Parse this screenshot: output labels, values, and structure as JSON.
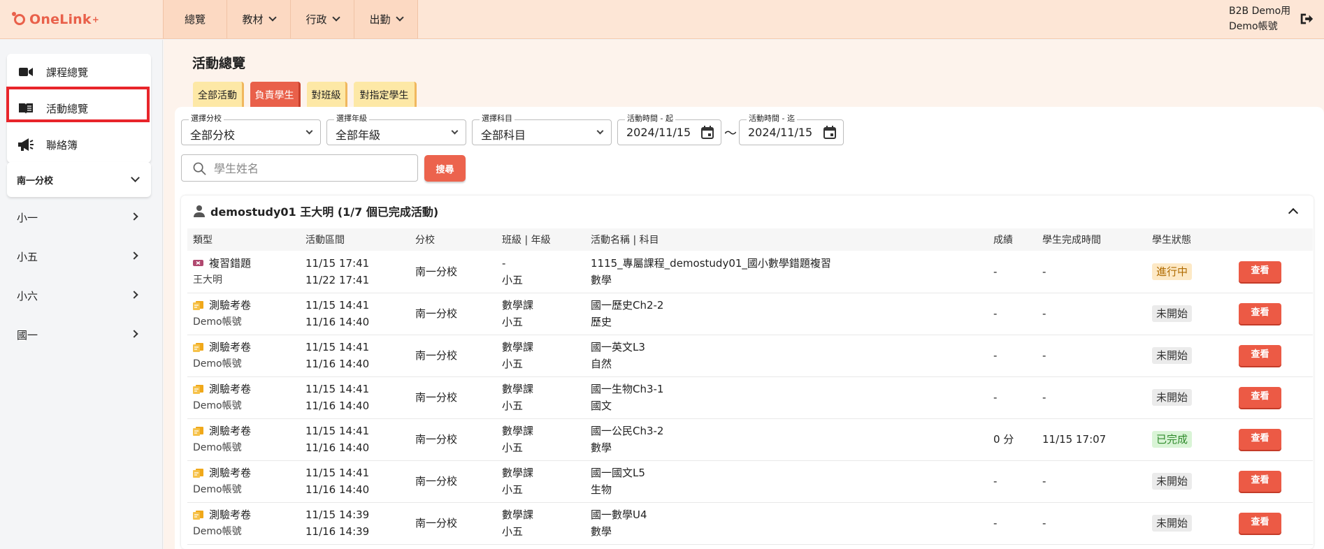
{
  "header": {
    "logo_text": "OneLink",
    "logo_plus": "+",
    "nav": [
      {
        "label": "總覽",
        "has_menu": false
      },
      {
        "label": "教材",
        "has_menu": true
      },
      {
        "label": "行政",
        "has_menu": true
      },
      {
        "label": "出勤",
        "has_menu": true
      }
    ],
    "user_line1": "B2B Demo用",
    "user_line2": "Demo帳號",
    "logout_icon": "logout-icon"
  },
  "sidebar": {
    "links": [
      {
        "label": "課程總覽",
        "icon": "video-camera-icon"
      },
      {
        "label": "活動總覽",
        "icon": "open-book-icon"
      },
      {
        "label": "聯絡簿",
        "icon": "megaphone-icon"
      }
    ],
    "branch": "南一分校",
    "grades": [
      "小一",
      "小五",
      "小六",
      "國一"
    ]
  },
  "page": {
    "title": "活動總覽",
    "tabs": [
      "全部活動",
      "負責學生",
      "對班級",
      "對指定學生"
    ],
    "active_tab": 1
  },
  "filters": {
    "branch": {
      "label": "選擇分校",
      "value": "全部分校"
    },
    "grade": {
      "label": "選擇年級",
      "value": "全部年級"
    },
    "subject": {
      "label": "選擇科目",
      "value": "全部科目"
    },
    "start": {
      "label": "活動時間 - 起",
      "value": "2024/11/15"
    },
    "end": {
      "label": "活動時間 - 迄",
      "value": "2024/11/15"
    },
    "separator": "～",
    "search_placeholder": "學生姓名",
    "search_button": "搜尋"
  },
  "student": {
    "header": "demostudy01 王大明 (1/7 個已完成活動)",
    "columns": [
      "類型",
      "活動區間",
      "分校",
      "班級 | 年級",
      "活動名稱 | 科目",
      "成績",
      "學生完成時間",
      "學生狀態",
      ""
    ],
    "rows": [
      {
        "type": "複習錯題",
        "type_kind": "review",
        "owner": "王大明",
        "start": "11/15 17:41",
        "end": "11/22 17:41",
        "branch": "南一分校",
        "class": "-",
        "grade": "小五",
        "name": "1115_專屬課程_demostudy01_國小數學錯題複習",
        "subject": "數學",
        "score": "-",
        "done_time": "-",
        "status": "進行中",
        "status_kind": "progress",
        "action": "查看"
      },
      {
        "type": "測驗考卷",
        "type_kind": "exam",
        "owner": "Demo帳號",
        "start": "11/15 14:41",
        "end": "11/16 14:40",
        "branch": "南一分校",
        "class": "數學課",
        "grade": "小五",
        "name": "國一歷史Ch2-2",
        "subject": "歷史",
        "score": "-",
        "done_time": "-",
        "status": "未開始",
        "status_kind": "none",
        "action": "查看"
      },
      {
        "type": "測驗考卷",
        "type_kind": "exam",
        "owner": "Demo帳號",
        "start": "11/15 14:41",
        "end": "11/16 14:40",
        "branch": "南一分校",
        "class": "數學課",
        "grade": "小五",
        "name": "國一英文L3",
        "subject": "自然",
        "score": "-",
        "done_time": "-",
        "status": "未開始",
        "status_kind": "none",
        "action": "查看"
      },
      {
        "type": "測驗考卷",
        "type_kind": "exam",
        "owner": "Demo帳號",
        "start": "11/15 14:41",
        "end": "11/16 14:40",
        "branch": "南一分校",
        "class": "數學課",
        "grade": "小五",
        "name": "國一生物Ch3-1",
        "subject": "國文",
        "score": "-",
        "done_time": "-",
        "status": "未開始",
        "status_kind": "none",
        "action": "查看"
      },
      {
        "type": "測驗考卷",
        "type_kind": "exam",
        "owner": "Demo帳號",
        "start": "11/15 14:41",
        "end": "11/16 14:40",
        "branch": "南一分校",
        "class": "數學課",
        "grade": "小五",
        "name": "國一公民Ch3-2",
        "subject": "數學",
        "score": "0 分",
        "done_time": "11/15 17:07",
        "status": "已完成",
        "status_kind": "done",
        "action": "查看"
      },
      {
        "type": "測驗考卷",
        "type_kind": "exam",
        "owner": "Demo帳號",
        "start": "11/15 14:41",
        "end": "11/16 14:40",
        "branch": "南一分校",
        "class": "數學課",
        "grade": "小五",
        "name": "國一國文L5",
        "subject": "生物",
        "score": "-",
        "done_time": "-",
        "status": "未開始",
        "status_kind": "none",
        "action": "查看"
      },
      {
        "type": "測驗考卷",
        "type_kind": "exam",
        "owner": "Demo帳號",
        "start": "11/15 14:39",
        "end": "11/16 14:39",
        "branch": "南一分校",
        "class": "數學課",
        "grade": "小五",
        "name": "國一數學U4",
        "subject": "數學",
        "score": "-",
        "done_time": "-",
        "status": "未開始",
        "status_kind": "none",
        "action": "查看"
      }
    ]
  },
  "colors": {
    "accent": "#ec634d",
    "header_bg": "#fde6d6",
    "tab_bg": "#fde8a6",
    "highlight_box": "#e8252b"
  }
}
